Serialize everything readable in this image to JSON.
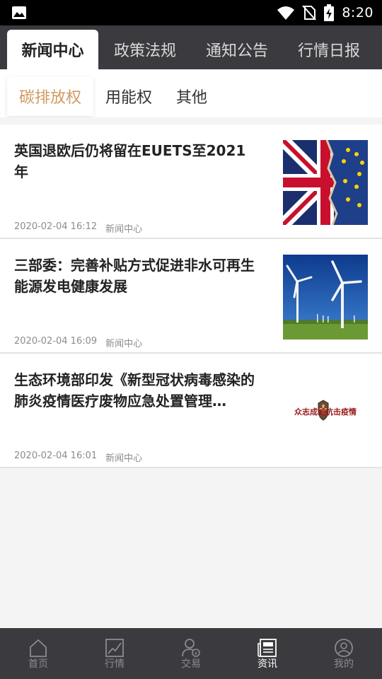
{
  "status_bar": {
    "time": "8:20",
    "icons": [
      "image-icon",
      "wifi-icon",
      "no-sim-icon",
      "battery-charging-icon"
    ]
  },
  "top_tabs": [
    {
      "label": "新闻中心",
      "active": true
    },
    {
      "label": "政策法规",
      "active": false
    },
    {
      "label": "通知公告",
      "active": false
    },
    {
      "label": "行情日报",
      "active": false
    }
  ],
  "sub_tabs": [
    {
      "label": "碳排放权",
      "active": true
    },
    {
      "label": "用能权",
      "active": false
    },
    {
      "label": "其他",
      "active": false
    }
  ],
  "news": [
    {
      "title": "英国退欧后仍将留在EUETS至2021年",
      "date": "2020-02-04 16:12",
      "source": "新闻中心",
      "thumb": "uk-eu-flag-image"
    },
    {
      "title": "三部委：完善补贴方式促进非水可再生能源发电健康发展",
      "date": "2020-02-04 16:09",
      "source": "新闻中心",
      "thumb": "wind-turbines-image"
    },
    {
      "title": "生态环境部印发《新型冠状病毒感染的肺炎疫情医疗废物应急处置管理…",
      "date": "2020-02-04 16:01",
      "source": "新闻中心",
      "thumb": "anti-epidemic-banner-image",
      "thumb_text": "众志成城抗击疫情"
    }
  ],
  "bottom_nav": [
    {
      "label": "首页",
      "icon": "home-icon",
      "active": false
    },
    {
      "label": "行情",
      "icon": "chart-icon",
      "active": false
    },
    {
      "label": "交易",
      "icon": "trade-icon",
      "active": false
    },
    {
      "label": "资讯",
      "icon": "news-icon",
      "active": true
    },
    {
      "label": "我的",
      "icon": "profile-icon",
      "active": false
    }
  ],
  "colors": {
    "dark_bar": "#3b3b3f",
    "accent": "#cf9b63",
    "background": "#f4f4f4"
  }
}
